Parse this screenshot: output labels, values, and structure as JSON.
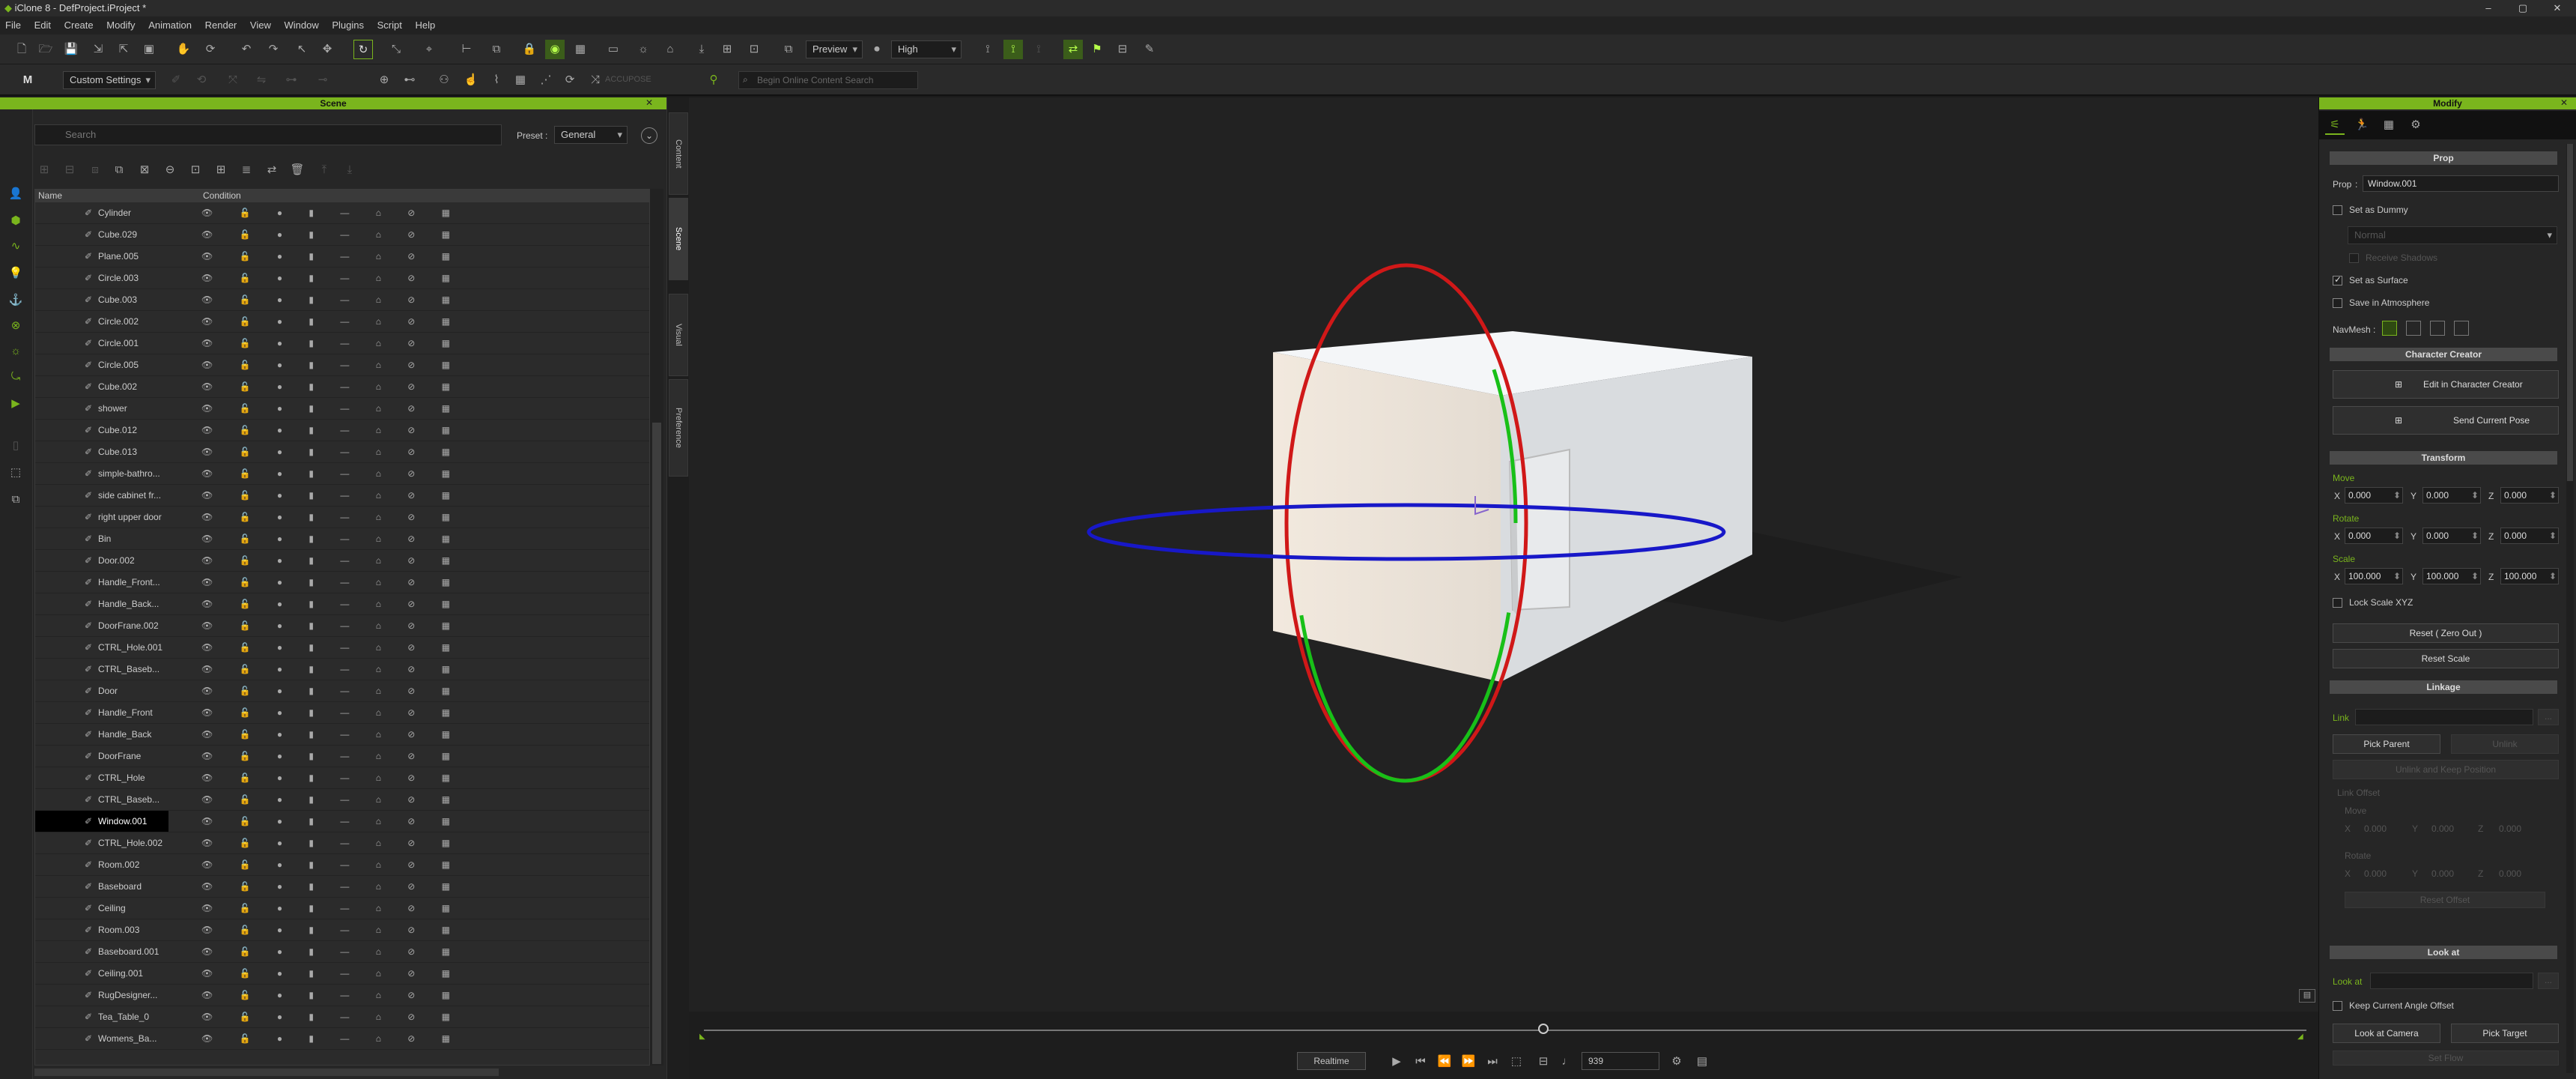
{
  "app": {
    "title": "iClone 8 - DefProject.iProject *",
    "min": "–",
    "max": "▢",
    "close": "✕"
  },
  "menu": [
    "File",
    "Edit",
    "Create",
    "Modify",
    "Animation",
    "Render",
    "View",
    "Window",
    "Plugins",
    "Script",
    "Help"
  ],
  "toolbar": {
    "preview_label": "Preview",
    "quality_label": "High",
    "settings_label": "Custom Settings",
    "accupose_label": "ACCUPOSE",
    "content_search_placeholder": "Begin Online Content Search"
  },
  "scene": {
    "title": "Scene",
    "search_placeholder": "Search",
    "preset_label": "Preset :",
    "preset_value": "General",
    "col_name": "Name",
    "col_condition": "Condition",
    "rows": [
      "Cylinder",
      "Cube.029",
      "Plane.005",
      "Circle.003",
      "Cube.003",
      "Circle.002",
      "Circle.001",
      "Circle.005",
      "Cube.002",
      "shower",
      "Cube.012",
      "Cube.013",
      "simple-bathro...",
      "side cabinet fr...",
      "right upper door",
      "Bin",
      "Door.002",
      "Handle_Front...",
      "Handle_Back...",
      "DoorFrane.002",
      "CTRL_Hole.001",
      "CTRL_Baseb...",
      "Door",
      "Handle_Front",
      "Handle_Back",
      "DoorFrane",
      "CTRL_Hole",
      "CTRL_Baseb...",
      "Window.001",
      "CTRL_Hole.002",
      "Room.002",
      "Baseboard",
      "Ceiling",
      "Room.003",
      "Baseboard.001",
      "Ceiling.001",
      "RugDesigner...",
      "Tea_Table_0",
      "Womens_Ba..."
    ],
    "selected": "Window.001",
    "row_icons": "👁 🔓 ● ▮ — ⌂ ⊘ ▦"
  },
  "side_tabs": [
    "Content",
    "Scene",
    "Visual",
    "Preference"
  ],
  "timeline": {
    "realtime_label": "Realtime",
    "frame_value": "939"
  },
  "modify": {
    "title": "Modify",
    "prop_section": "Prop",
    "prop_label": "Prop",
    "prop_value": "Window.001",
    "set_as_dummy": "Set as Dummy",
    "dummy_combo": "Normal",
    "receive_shadows": "Receive Shadows",
    "set_as_surface": "Set as Surface",
    "save_in_atmosphere": "Save in Atmosphere",
    "navmesh_label": "NavMesh :",
    "cc_section": "Character Creator",
    "edit_in_cc": "Edit in Character Creator",
    "send_pose": "Send Current Pose",
    "transform_section": "Transform",
    "move_label": "Move",
    "rotate_label": "Rotate",
    "scale_label": "Scale",
    "x": "X",
    "y": "Y",
    "z": "Z",
    "move": [
      "0.000",
      "0.000",
      "0.000"
    ],
    "rotate": [
      "0.000",
      "0.000",
      "0.000"
    ],
    "scale": [
      "100.000",
      "100.000",
      "100.000"
    ],
    "lock_scale": "Lock Scale XYZ",
    "reset_zero": "Reset ( Zero Out )",
    "reset_scale": "Reset Scale",
    "linkage_section": "Linkage",
    "link_label": "Link",
    "pick_parent": "Pick Parent",
    "unlink": "Unlink",
    "unlink_keep": "Unlink and Keep Position",
    "link_offset": "Link Offset",
    "lo_move": "Move",
    "lo_rotate": "Rotate",
    "lo_zero": "0.000",
    "reset_offset": "Reset Offset",
    "lookat_section": "Look at",
    "lookat_label": "Look at",
    "keep_angle": "Keep Current Angle Offset",
    "look_at_camera": "Look at Camera",
    "pick_target": "Pick Target",
    "set_flow": "Set Flow",
    "more": "..."
  },
  "colors": {
    "accent": "#7ab51d",
    "gizmo_x": "#d01818",
    "gizmo_y": "#18c018",
    "gizmo_z": "#1818c8"
  }
}
